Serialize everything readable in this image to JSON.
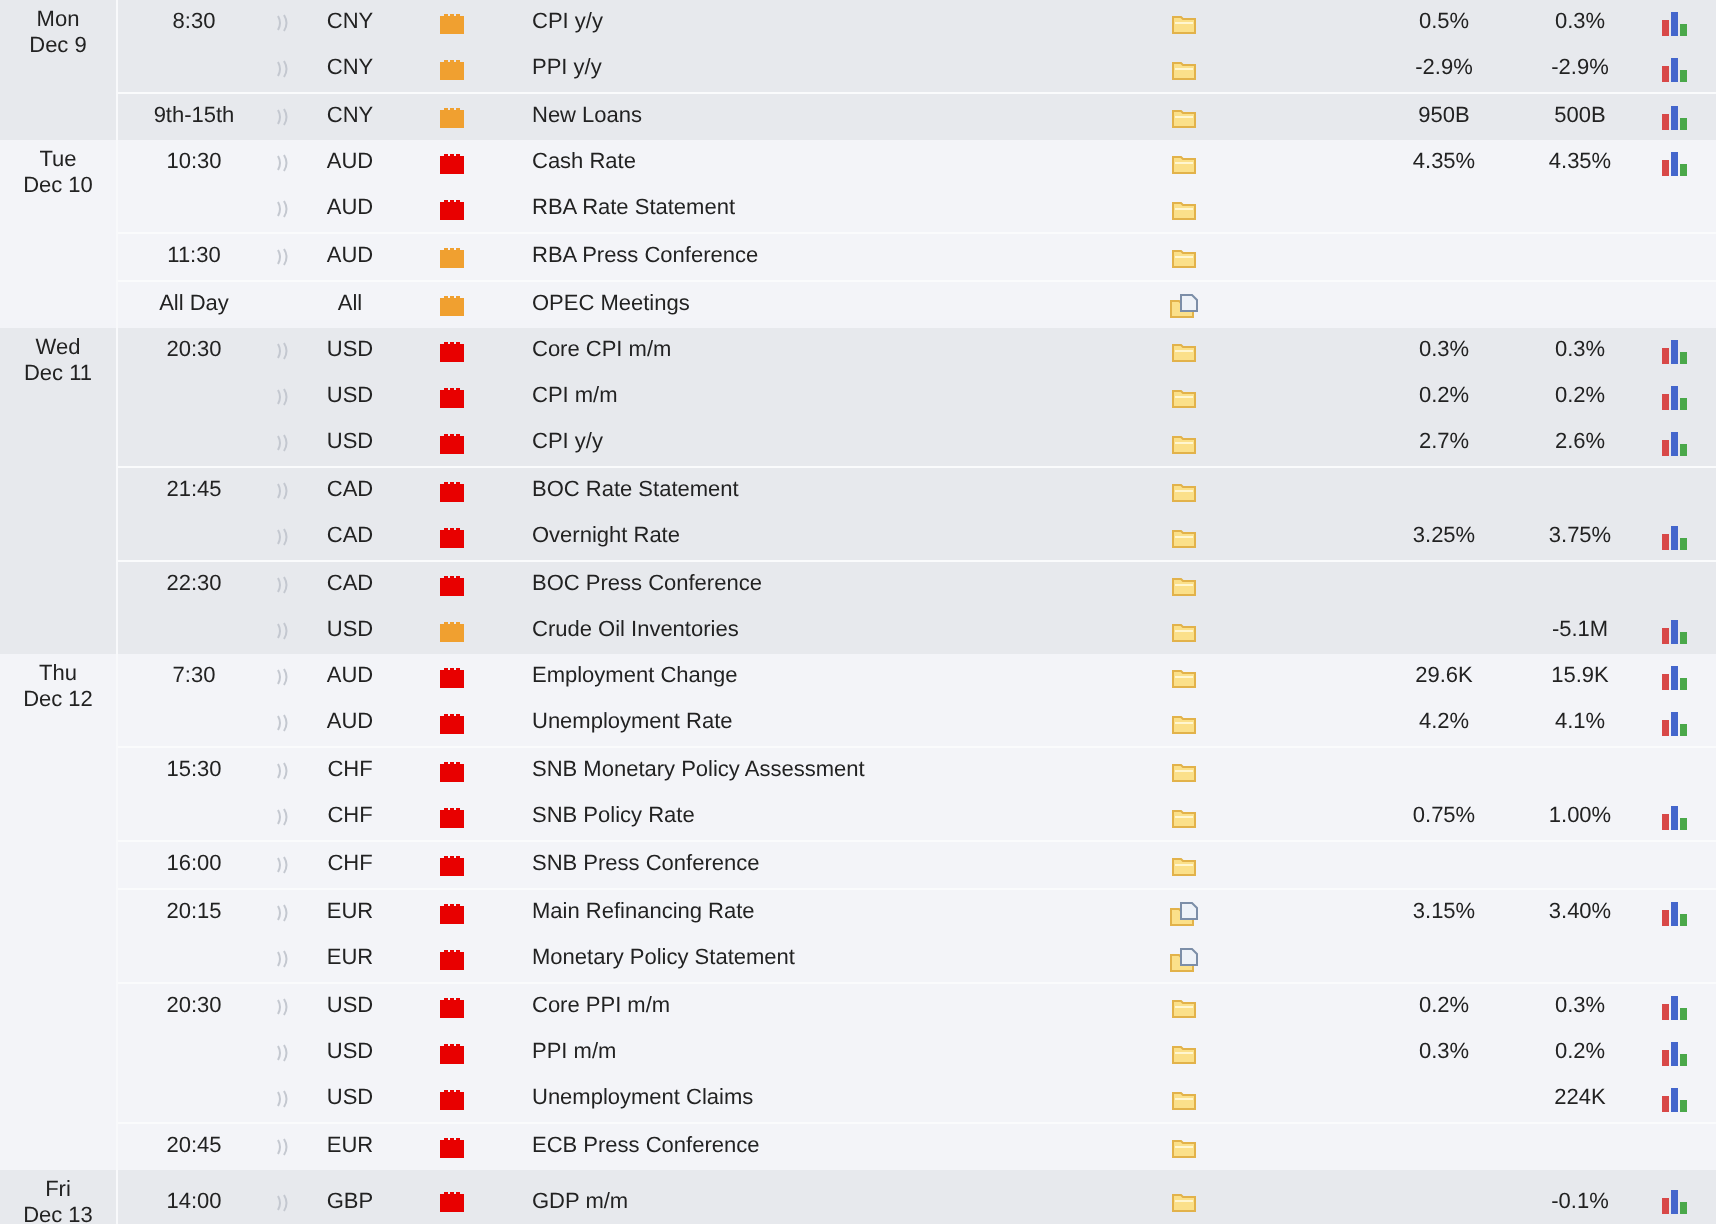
{
  "days": [
    {
      "weekday": "Mon",
      "date": "Dec 9",
      "groups": [
        {
          "time": "8:30",
          "events": [
            {
              "sound": true,
              "currency": "CNY",
              "color": "#f0a030",
              "title": "CPI y/y",
              "kind": "folder",
              "value_1": "0.5%",
              "value_2": "0.3%",
              "chart": true
            },
            {
              "sound": true,
              "currency": "CNY",
              "color": "#f0a030",
              "title": "PPI y/y",
              "kind": "folder",
              "value_1": "-2.9%",
              "value_2": "-2.9%",
              "chart": true
            }
          ]
        },
        {
          "time": "9th-15th",
          "events": [
            {
              "sound": true,
              "currency": "CNY",
              "color": "#f0a030",
              "title": "New Loans",
              "kind": "folder",
              "value_1": "950B",
              "value_2": "500B",
              "chart": true
            }
          ]
        }
      ]
    },
    {
      "weekday": "Tue",
      "date": "Dec 10",
      "groups": [
        {
          "time": "10:30",
          "events": [
            {
              "sound": true,
              "currency": "AUD",
              "color": "#e80000",
              "title": "Cash Rate",
              "kind": "folder",
              "value_1": "4.35%",
              "value_2": "4.35%",
              "chart": true
            },
            {
              "sound": true,
              "currency": "AUD",
              "color": "#e80000",
              "title": "RBA Rate Statement",
              "kind": "folder",
              "chart": false
            }
          ]
        },
        {
          "time": "11:30",
          "events": [
            {
              "sound": true,
              "currency": "AUD",
              "color": "#f0a030",
              "title": "RBA Press Conference",
              "kind": "folder",
              "chart": false
            }
          ]
        },
        {
          "time": "All Day",
          "events": [
            {
              "sound": false,
              "currency": "All",
              "color": "#f0a030",
              "title": "OPEC Meetings",
              "kind": "folder-doc",
              "chart": false
            }
          ]
        }
      ]
    },
    {
      "weekday": "Wed",
      "date": "Dec 11",
      "groups": [
        {
          "time": "20:30",
          "events": [
            {
              "sound": true,
              "currency": "USD",
              "color": "#e80000",
              "title": "Core CPI m/m",
              "kind": "folder",
              "value_1": "0.3%",
              "value_2": "0.3%",
              "chart": true
            },
            {
              "sound": true,
              "currency": "USD",
              "color": "#e80000",
              "title": "CPI m/m",
              "kind": "folder",
              "value_1": "0.2%",
              "value_2": "0.2%",
              "chart": true
            },
            {
              "sound": true,
              "currency": "USD",
              "color": "#e80000",
              "title": "CPI y/y",
              "kind": "folder",
              "value_1": "2.7%",
              "value_2": "2.6%",
              "chart": true
            }
          ]
        },
        {
          "time": "21:45",
          "events": [
            {
              "sound": true,
              "currency": "CAD",
              "color": "#e80000",
              "title": "BOC Rate Statement",
              "kind": "folder",
              "chart": false
            },
            {
              "sound": true,
              "currency": "CAD",
              "color": "#e80000",
              "title": "Overnight Rate",
              "kind": "folder",
              "value_1": "3.25%",
              "value_2": "3.75%",
              "chart": true
            }
          ]
        },
        {
          "time": "22:30",
          "events": [
            {
              "sound": true,
              "currency": "CAD",
              "color": "#e80000",
              "title": "BOC Press Conference",
              "kind": "folder",
              "chart": false
            },
            {
              "sound": true,
              "currency": "USD",
              "color": "#f0a030",
              "title": "Crude Oil Inventories",
              "kind": "folder",
              "value_2": "-5.1M",
              "chart": true
            }
          ]
        }
      ]
    },
    {
      "weekday": "Thu",
      "date": "Dec 12",
      "groups": [
        {
          "time": "7:30",
          "events": [
            {
              "sound": true,
              "currency": "AUD",
              "color": "#e80000",
              "title": "Employment Change",
              "kind": "folder",
              "value_1": "29.6K",
              "value_2": "15.9K",
              "chart": true
            },
            {
              "sound": true,
              "currency": "AUD",
              "color": "#e80000",
              "title": "Unemployment Rate",
              "kind": "folder",
              "value_1": "4.2%",
              "value_2": "4.1%",
              "chart": true
            }
          ]
        },
        {
          "time": "15:30",
          "events": [
            {
              "sound": true,
              "currency": "CHF",
              "color": "#e80000",
              "title": "SNB Monetary Policy Assessment",
              "kind": "folder",
              "chart": false
            },
            {
              "sound": true,
              "currency": "CHF",
              "color": "#e80000",
              "title": "SNB Policy Rate",
              "kind": "folder",
              "value_1": "0.75%",
              "value_2": "1.00%",
              "chart": true
            }
          ]
        },
        {
          "time": "16:00",
          "events": [
            {
              "sound": true,
              "currency": "CHF",
              "color": "#e80000",
              "title": "SNB Press Conference",
              "kind": "folder",
              "chart": false
            }
          ]
        },
        {
          "time": "20:15",
          "events": [
            {
              "sound": true,
              "currency": "EUR",
              "color": "#e80000",
              "title": "Main Refinancing Rate",
              "kind": "folder-doc",
              "value_1": "3.15%",
              "value_2": "3.40%",
              "chart": true
            },
            {
              "sound": true,
              "currency": "EUR",
              "color": "#e80000",
              "title": "Monetary Policy Statement",
              "kind": "folder-doc",
              "chart": false
            }
          ]
        },
        {
          "time": "20:30",
          "events": [
            {
              "sound": true,
              "currency": "USD",
              "color": "#e80000",
              "title": "Core PPI m/m",
              "kind": "folder",
              "value_1": "0.2%",
              "value_2": "0.3%",
              "chart": true
            },
            {
              "sound": true,
              "currency": "USD",
              "color": "#e80000",
              "title": "PPI m/m",
              "kind": "folder",
              "value_1": "0.3%",
              "value_2": "0.2%",
              "chart": true
            },
            {
              "sound": true,
              "currency": "USD",
              "color": "#e80000",
              "title": "Unemployment Claims",
              "kind": "folder",
              "value_2": "224K",
              "chart": true
            }
          ]
        },
        {
          "time": "20:45",
          "events": [
            {
              "sound": true,
              "currency": "EUR",
              "color": "#e80000",
              "title": "ECB Press Conference",
              "kind": "folder",
              "chart": false
            }
          ]
        }
      ]
    },
    {
      "weekday": "Fri",
      "date": "Dec 13",
      "groups": [
        {
          "time": "14:00",
          "events": [
            {
              "sound": true,
              "currency": "GBP",
              "color": "#e80000",
              "title": "GDP m/m",
              "kind": "folder",
              "value_2": "-0.1%",
              "chart": true
            }
          ]
        }
      ]
    }
  ]
}
